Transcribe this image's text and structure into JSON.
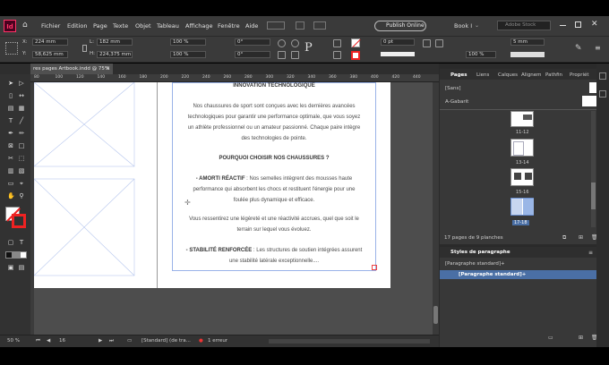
{
  "menubar": {
    "items": [
      "Fichier",
      "Edition",
      "Page",
      "Texte",
      "Objet",
      "Tableau",
      "Affichage",
      "Fenêtre",
      "Aide"
    ],
    "publish_label": "Publish Online",
    "workspace_label": "Book I",
    "search_placeholder": "Adobe Stock"
  },
  "controlbar": {
    "x": "224 mm",
    "y": "58,625 mm",
    "w": "182 mm",
    "h": "224,375 mm",
    "scale_x": "100 %",
    "scale_y": "100 %",
    "rotate": "0°",
    "shear": "0°",
    "stroke_weight": "0 pt",
    "percent": "100 %",
    "gutter": "5 mm",
    "refpoint_char": "P"
  },
  "document": {
    "tab_title": "res pages Artbook.indd @ 75%",
    "ruler_ticks": [
      "80",
      "100",
      "120",
      "140",
      "160",
      "180",
      "200",
      "220",
      "240",
      "260",
      "280",
      "300",
      "320",
      "340",
      "360",
      "380",
      "400",
      "420",
      "440"
    ]
  },
  "page": {
    "heading1": "INNOVATION TECHNOLOGIQUE",
    "para1_lines": [
      "Nos chaussures de sport sont conçues avec les dernières avancées",
      "technologiques pour garantir une performance optimale, que vous soyez",
      "un athlète professionnel ou un amateur passionné. Chaque paire intègre",
      "des technologies de pointe."
    ],
    "heading2": "POURQUOI CHOISIR NOS CHAUSSURES ?",
    "bullet1_bold": "- AMORTI RÉACTIF",
    "bullet1_lines": [
      " : Nos semelles intègrent des mousses haute",
      "performance qui absorbent les chocs et restituent l'énergie pour une",
      "foulée plus dynamique et efficace."
    ],
    "para2_lines": [
      "Vous ressentirez une légèreté et une réactivité accrues, quel que soit le",
      "terrain sur lequel vous évoluez."
    ],
    "bullet2_bold": "- STABILITÉ RENFORCÉE",
    "bullet2_lines": [
      " : Les structures de soutien intégrées assurent",
      "une stabilité latérale exceptionnelle...."
    ]
  },
  "statusbar": {
    "zoom": "50 %",
    "page_number": "16",
    "style": "[Standard] (de tra...",
    "errors": "1 erreur"
  },
  "panels": {
    "tabs": [
      "Pages",
      "Liens",
      "Calques",
      "Alignem",
      "Pathfin",
      "Propriét"
    ],
    "master_none": "[Sans]",
    "master_a": "A-Gabarit",
    "spreads": [
      "11-12",
      "13-14",
      "15-16",
      "17-18"
    ],
    "pages_status": "17 pages de 9 planches",
    "para_panel_title": "Styles de paragraphe",
    "para_current": "[Paragraphe standard]+",
    "para_item": "[Paragraphe standard]+"
  },
  "colors": {
    "accent": "#ff3366",
    "selection": "#4a6fa5",
    "frame": "#7fa0e0"
  }
}
